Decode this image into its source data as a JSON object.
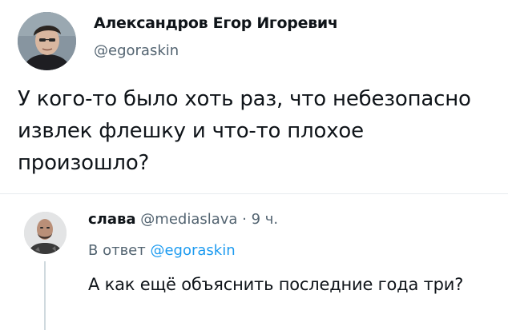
{
  "post": {
    "author_name": "Александров Егор Игоревич",
    "author_handle": "@egoraskin",
    "text": "У кого-то было хоть раз, что небезопасно извлек флешку и что-то плохое произошло?"
  },
  "reply": {
    "author_name": "слава",
    "author_handle": "@mediaslava",
    "separator": " · ",
    "time": "9 ч.",
    "reply_to_label": "В ответ",
    "reply_to_handle": "@egoraskin",
    "text": "А как ещё объяснить последние года три?"
  }
}
